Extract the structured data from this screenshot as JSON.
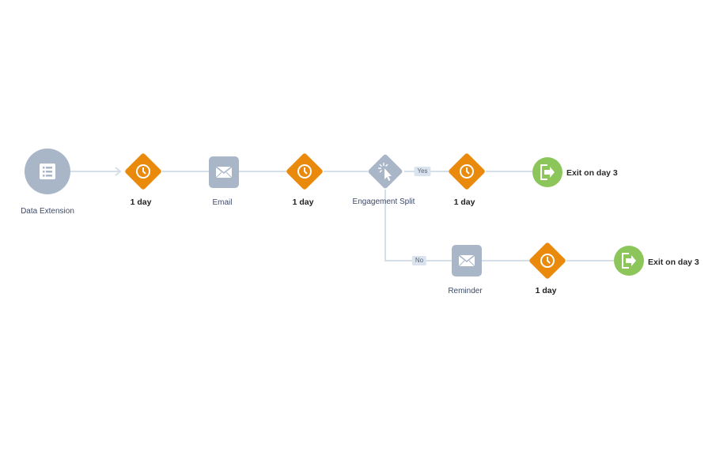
{
  "colors": {
    "connector": "#d4dfea",
    "entry_node": "#a9b6c8",
    "wait_node": "#ea8a0c",
    "email_node": "#a9b6c8",
    "split_node": "#a9b6c8",
    "exit_node": "#8cc65a",
    "tag_bg": "#dbe4ee"
  },
  "nodes": [
    {
      "id": "entry",
      "type": "data-extension",
      "icon": "list-icon",
      "label": "Data Extension"
    },
    {
      "id": "wait1",
      "type": "wait",
      "icon": "clock-icon",
      "label": "1 day"
    },
    {
      "id": "email",
      "type": "email",
      "icon": "envelope-icon",
      "label": "Email"
    },
    {
      "id": "wait2",
      "type": "wait",
      "icon": "clock-icon",
      "label": "1 day"
    },
    {
      "id": "split",
      "type": "engagement-split",
      "icon": "click-cursor-icon",
      "label": "Engagement Split"
    },
    {
      "id": "wait3",
      "type": "wait",
      "icon": "clock-icon",
      "label": "1 day"
    },
    {
      "id": "exit1",
      "type": "exit",
      "icon": "exit-icon",
      "label": "Exit on day 3"
    },
    {
      "id": "reminder",
      "type": "email",
      "icon": "envelope-icon",
      "label": "Reminder"
    },
    {
      "id": "wait4",
      "type": "wait",
      "icon": "clock-icon",
      "label": "1 day"
    },
    {
      "id": "exit2",
      "type": "exit",
      "icon": "exit-icon",
      "label": "Exit on day 3"
    }
  ],
  "branches": {
    "yes_label": "Yes",
    "no_label": "No"
  }
}
